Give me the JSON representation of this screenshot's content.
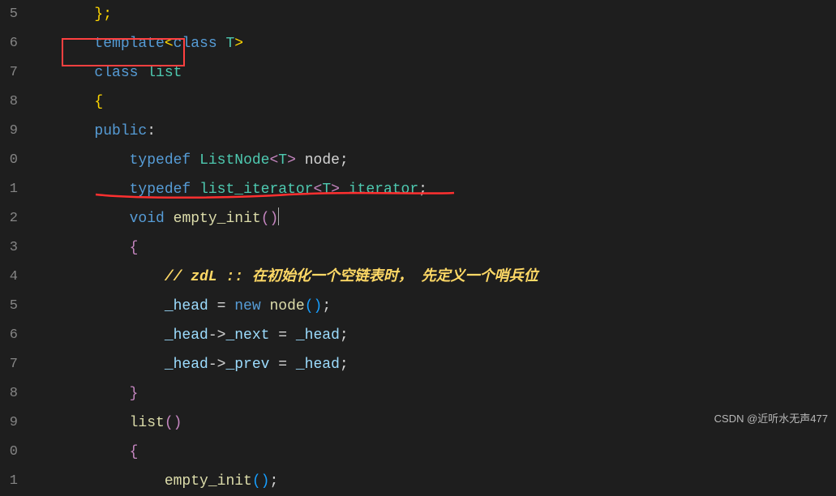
{
  "gutter": [
    "5",
    "6",
    "7",
    "8",
    "9",
    "0",
    "1",
    "2",
    "3",
    "4",
    "5",
    "6",
    "7",
    "8",
    "9",
    "0",
    "1"
  ],
  "code": {
    "l0": {
      "i": "        ",
      "b": "};"
    },
    "l1": {
      "i": "        ",
      "a": "template",
      "b": "<",
      "c": "class",
      "d": " T",
      "e": ">"
    },
    "l2": {
      "i": "        ",
      "a": "class",
      "b": " list"
    },
    "l3": {
      "i": "        ",
      "a": "{"
    },
    "l4": {
      "i": "        ",
      "a": "public",
      "b": ":"
    },
    "l5": {
      "i": "            ",
      "a": "typedef",
      "b": " ",
      "c": "ListNode",
      "d": "<",
      "e": "T",
      "f": ">",
      "g": " node;"
    },
    "l6": {
      "i": "            ",
      "a": "typedef",
      "b": " ",
      "c": "list_iterator",
      "d": "<",
      "e": "T",
      "f": ">",
      "g": " ",
      "h": "iterator",
      "j": ";"
    },
    "l7": {
      "i": "            ",
      "a": "void",
      "b": " ",
      "c": "empty_init",
      "d": "(",
      "e": ")"
    },
    "l8": {
      "i": "            ",
      "a": "{"
    },
    "l9": {
      "i": "                ",
      "a": "// zdL :: 在初始化一个空链表时， 先定义一个哨兵位"
    },
    "l10": {
      "i": "                ",
      "a": "_head",
      "b": " = ",
      "c": "new",
      "d": " ",
      "e": "node",
      "f": "(",
      "g": ")",
      "h": ";"
    },
    "l11": {
      "i": "                ",
      "a": "_head",
      "b": "->",
      "c": "_next",
      "d": " = ",
      "e": "_head",
      "f": ";"
    },
    "l12": {
      "i": "                ",
      "a": "_head",
      "b": "->",
      "c": "_prev",
      "d": " = ",
      "e": "_head",
      "f": ";"
    },
    "l13": {
      "i": "            ",
      "a": "}"
    },
    "l14": {
      "i": "            ",
      "a": "list",
      "b": "(",
      "c": ")"
    },
    "l15": {
      "i": "            ",
      "a": "{"
    },
    "l16": {
      "i": "                ",
      "a": "empty_init",
      "b": "(",
      "c": ")",
      "d": ";"
    }
  },
  "watermark": "CSDN @近听水无声477"
}
